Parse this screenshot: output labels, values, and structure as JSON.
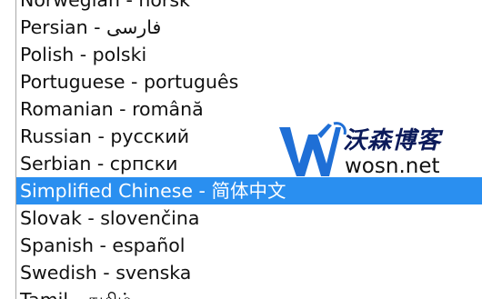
{
  "listbox": {
    "selected_index": 7,
    "options": [
      {
        "label": "Norwegian - norsk"
      },
      {
        "label": "Persian - فارسی"
      },
      {
        "label": "Polish - polski"
      },
      {
        "label": "Portuguese - português"
      },
      {
        "label": "Romanian - română"
      },
      {
        "label": "Russian - русский"
      },
      {
        "label": "Serbian - српски"
      },
      {
        "label": "Simplified Chinese - 简体中文"
      },
      {
        "label": "Slovak - slovenčina"
      },
      {
        "label": "Spanish - español"
      },
      {
        "label": "Swedish - svenska"
      },
      {
        "label": "Tamil - தமிழ்"
      }
    ]
  },
  "watermark": {
    "brand_cn": "沃森博客",
    "url": "wosn.net",
    "logo_icon": "w-logo-icon"
  },
  "colors": {
    "selection_bg": "#2a8ff0",
    "selection_text": "#ffffff",
    "option_text": "#111111",
    "logo_blue": "#1f6fd6",
    "brand_dark": "#0b1a5a"
  }
}
